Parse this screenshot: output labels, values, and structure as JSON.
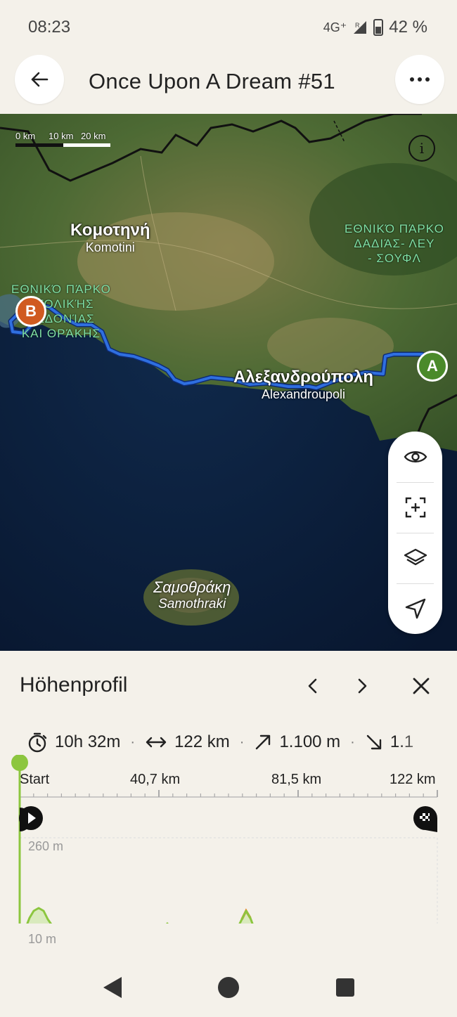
{
  "status_bar": {
    "time": "08:23",
    "network": "4G⁺",
    "roaming": "R",
    "battery": "42 %"
  },
  "header": {
    "title": "Once Upon A Dream #51",
    "back_icon": "arrow-left-icon",
    "more_icon": "more-horizontal-icon"
  },
  "map": {
    "scale": {
      "labels": [
        "0 km",
        "10 km",
        "20 km"
      ]
    },
    "places": {
      "komotini": {
        "name": "Κομοτηνή",
        "latin": "Komotini"
      },
      "alexandroupoli": {
        "name": "Αλεξανδρούπολη",
        "latin": "Alexandroupoli"
      },
      "samothraki": {
        "name": "Σαμοθράκη",
        "latin": "Samothraki"
      }
    },
    "parks": {
      "east": [
        "ΕΘΝΙΚΌ ΠΆΡΚΟ",
        "ΔΑΔΙΆΣ- ΛΕΥ",
        "- ΣΟΥΦΛ"
      ],
      "west": [
        "ΕΘΝΙΚΌ ΠΆΡΚΟ",
        "ΑΤΟΛΙΚΉΣ",
        "ΚΕΔΟΝΊΑΣ",
        "ΚΑΙ ΘΡΆΚΗΣ"
      ]
    },
    "markers": {
      "start": "A",
      "end": "B"
    },
    "info_icon": "info-icon",
    "route_color": "#2f6fe0",
    "tools": [
      "eye-icon",
      "recenter-icon",
      "layers-icon",
      "navigate-icon"
    ]
  },
  "elevation": {
    "title": "Höhenprofil",
    "nav_icons": [
      "chevron-left-icon",
      "chevron-right-icon",
      "close-icon"
    ],
    "stats": {
      "duration": "10h 32m",
      "distance": "122 km",
      "ascent": "1.100 m",
      "descent": "1.1"
    },
    "distance_labels": [
      "Start",
      "40,7 km",
      "81,5 km",
      "122 km"
    ],
    "elevation_labels": {
      "max": "260 m",
      "min": "10 m"
    },
    "colors": {
      "line": "#8cc63f",
      "fill": "#d6e9b8",
      "steep": "#f07d1e"
    }
  },
  "navbar": {
    "icons": [
      "back-triangle-icon",
      "home-circle-icon",
      "recents-square-icon"
    ]
  }
}
